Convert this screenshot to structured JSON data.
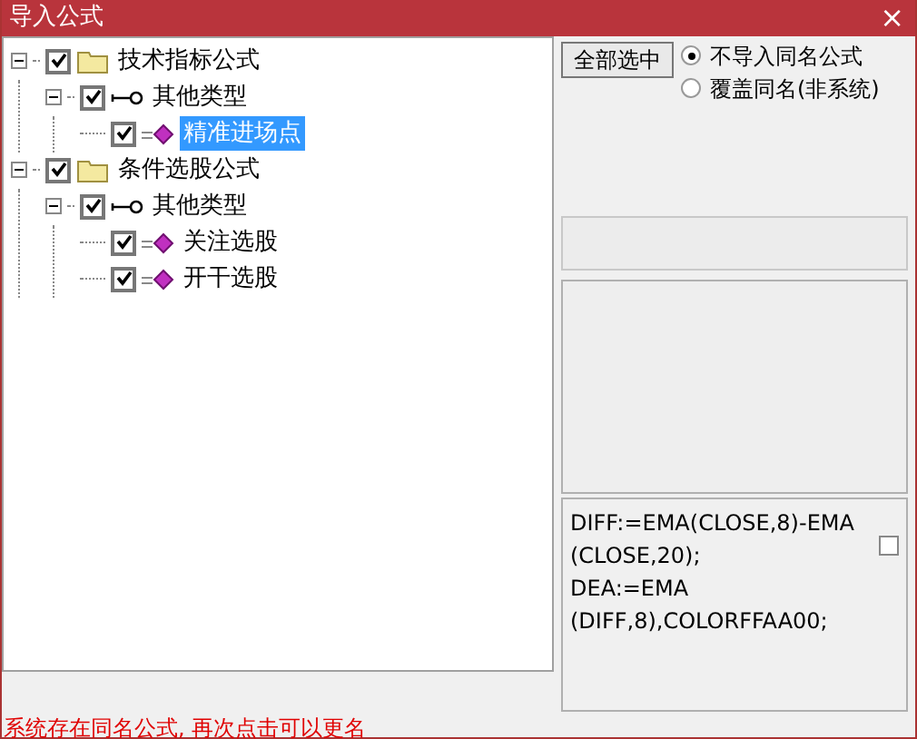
{
  "window": {
    "title": "导入公式",
    "close": "×"
  },
  "tree": [
    {
      "label": "技术指标公式",
      "kind": "folder",
      "checked": true,
      "expanded": true,
      "selected": false,
      "children": [
        {
          "label": "其他类型",
          "kind": "type",
          "checked": true,
          "expanded": true,
          "selected": false,
          "children": [
            {
              "label": "精准进场点",
              "kind": "formula",
              "checked": true,
              "selected": true
            }
          ]
        }
      ]
    },
    {
      "label": "条件选股公式",
      "kind": "folder",
      "checked": true,
      "expanded": true,
      "selected": false,
      "children": [
        {
          "label": "其他类型",
          "kind": "type",
          "checked": true,
          "expanded": true,
          "selected": false,
          "children": [
            {
              "label": "关注选股",
              "kind": "formula",
              "checked": true,
              "selected": false
            },
            {
              "label": "开干选股",
              "kind": "formula",
              "checked": true,
              "selected": false
            }
          ]
        }
      ]
    }
  ],
  "select_all_button": "全部选中",
  "options": [
    {
      "label": "不导入同名公式",
      "selected": true
    },
    {
      "label": "覆盖同名(非系统)",
      "selected": false
    }
  ],
  "formula_text": {
    "lines": [
      "DIFF:=EMA(CLOSE,8)-EMA",
      "(CLOSE,20);",
      "DEA:=EMA",
      "(DIFF,8),COLORFFAA00;"
    ],
    "checked": false
  },
  "status": "系统存在同名公式, 再次点击可以更名"
}
